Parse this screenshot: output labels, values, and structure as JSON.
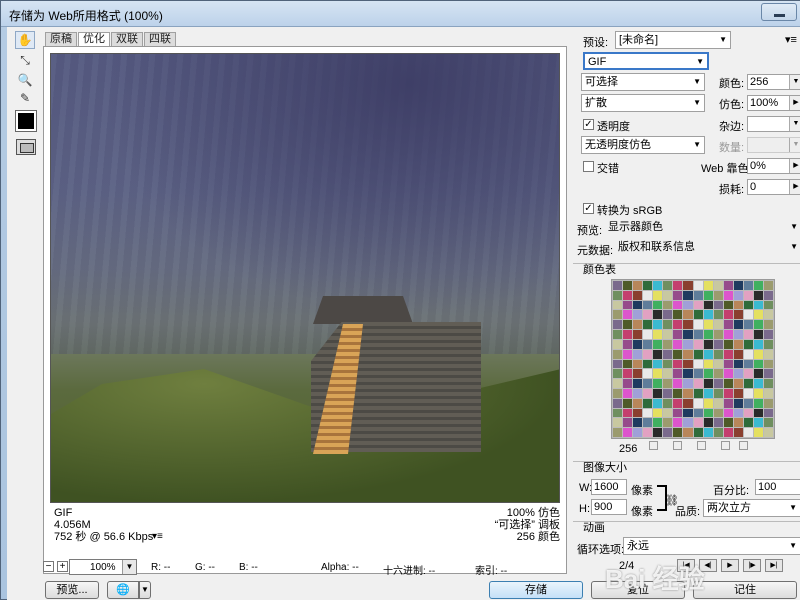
{
  "window": {
    "title": "存储为 Web所用格式 (100%)"
  },
  "tabs": [
    {
      "label": "原稿"
    },
    {
      "label": "优化"
    },
    {
      "label": "双联"
    },
    {
      "label": "四联"
    }
  ],
  "tools": [
    "hand-tool-icon",
    "slice-select-tool-icon",
    "zoom-tool-icon",
    "eyedropper-tool-icon"
  ],
  "tool_glyphs": {
    "hand": "✋",
    "slice": "⤡",
    "zoom": "🔍",
    "eyedropper": "✎"
  },
  "eyedropper_color": "#000000",
  "preview_info": {
    "format": "GIF",
    "size": "4.056M",
    "time": "752 秒 @ 56.6 Kbps",
    "menu_glyph": "▾≡",
    "dither": "100% 仿色",
    "palette": "“可选择” 调板",
    "colors": "256 颜色"
  },
  "status": {
    "zoom_minus": "−",
    "zoom_plus": "+",
    "zoom": "100%",
    "r": "R: --",
    "g": "G: --",
    "b": "B: --",
    "alpha": "Alpha: --",
    "hex": "十六进制: --",
    "index": "索引: --"
  },
  "bottom": {
    "preview_label": "预览...",
    "save_label": "存储",
    "reset_label": "复位",
    "remember_label": "记住"
  },
  "settings": {
    "preset_label": "预设:",
    "preset_value": "[未命名]",
    "format": "GIF",
    "reduction": "可选择",
    "dither_algo": "扩散",
    "transparency_label": "透明度",
    "transparency_dither": "无透明度仿色",
    "interlace_label": "交错",
    "colors_label": "颜色:",
    "colors_value": "256",
    "dither_label": "仿色:",
    "dither_value": "100%",
    "matte_label": "杂边:",
    "amount_label": "数量:",
    "websnap_label": "Web 靠色:",
    "websnap_value": "0%",
    "lossy_label": "损耗:",
    "lossy_value": "0",
    "convert_srgb_label": "转换为 sRGB",
    "preview_label": "预览:",
    "preview_value": "显示器颜色",
    "metadata_label": "元数据:",
    "metadata_value": "版权和联系信息"
  },
  "color_table": {
    "title": "颜色表",
    "count": "256"
  },
  "image_size": {
    "title": "图像大小",
    "w_label": "W:",
    "w_value": "1600",
    "h_label": "H:",
    "h_value": "900",
    "unit": "像素",
    "percent_label": "百分比:",
    "percent_value": "100",
    "quality_label": "品质:",
    "quality_value": "两次立方"
  },
  "animation": {
    "title": "动画",
    "loop_label": "循环选项:",
    "loop_value": "永远",
    "frame": "2/4"
  },
  "watermark": "Bai 经验",
  "colors": {
    "accent": "#3a78c8",
    "primary_button": "#c4e0f7"
  }
}
